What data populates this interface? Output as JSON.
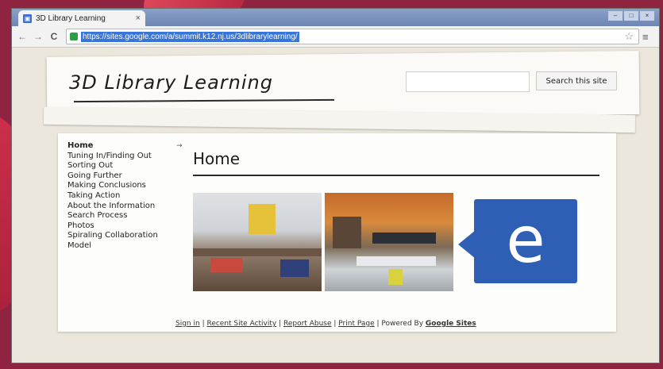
{
  "browser": {
    "tab_title": "3D Library Learning",
    "tab_close": "×",
    "url": "https://sites.google.com/a/summit.k12.nj.us/3dlibrarylearning/",
    "window_controls": [
      "–",
      "□",
      "×"
    ]
  },
  "header": {
    "site_title": "3D Library Learning",
    "search_placeholder": "",
    "search_button": "Search this site"
  },
  "sidebar": {
    "items": [
      {
        "label": "Home"
      },
      {
        "label": "Tuning In/Finding Out"
      },
      {
        "label": "Sorting Out"
      },
      {
        "label": "Going Further"
      },
      {
        "label": "Making Conclusions"
      },
      {
        "label": "Taking Action"
      },
      {
        "label": "About the Information"
      },
      {
        "label": "Search Process"
      },
      {
        "label": "Photos"
      },
      {
        "label": "Spiraling Collaboration"
      },
      {
        "label": "Model"
      }
    ],
    "active_arrow": "→"
  },
  "main": {
    "heading": "Home",
    "edmodo_letter": "e"
  },
  "footer": {
    "sign_in": "Sign in",
    "recent_activity": "Recent Site Activity",
    "report_abuse": "Report Abuse",
    "print_page": "Print Page",
    "powered_by": "Powered By",
    "google_sites": "Google Sites",
    "sep": " | "
  },
  "colors": {
    "frame": "#8e2440",
    "url_highlight": "#3875d7",
    "edmodo_blue": "#2f5fb5"
  }
}
